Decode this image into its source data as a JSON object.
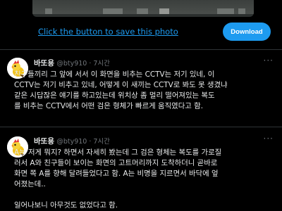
{
  "banner": {
    "save_link": "Click the button to save this photo",
    "download_label": "Download",
    "accent": "#1d9bf0"
  },
  "tweets": [
    {
      "display_name": "바또용",
      "handle_time": "@bty910 · 7시간",
      "avatar": "bird-avatar",
      "more": "···",
      "lines": [
        "친구들끼리 그 앞에 서서 이 화면을 비추는 CCTV는 저기 있네, 이",
        "CCTV는 저기 비추고 있네, 어떻게 이 새끼는 CCTV로 봐도 못 생겼냐",
        "같은 시답잖은 얘기를 하고있는데 위치상 좀 멀리 떨어져있는 복도",
        "를 비추는 CCTV에서 어떤 검은 형체가 빠르게 움직였다고 함."
      ]
    },
    {
      "display_name": "바또용",
      "handle_time": "@bty910 · 7시간",
      "avatar": "bird-avatar",
      "more": "···",
      "lines": [
        "A는 저게 뭐지? 하면서 자세히 봤는데 그 검은 형체는 복도를 가로질",
        "러서 A와 친구들이 보이는 화면의 고트머리까지 도착하더니 곧바로",
        "화면 쪽 A를 향해 달려들었다고 함. A는 비명을 지르면서 바닥에 엎",
        "어졌는데..",
        "",
        "일어나보니 아무것도 없었다고 함."
      ]
    }
  ]
}
